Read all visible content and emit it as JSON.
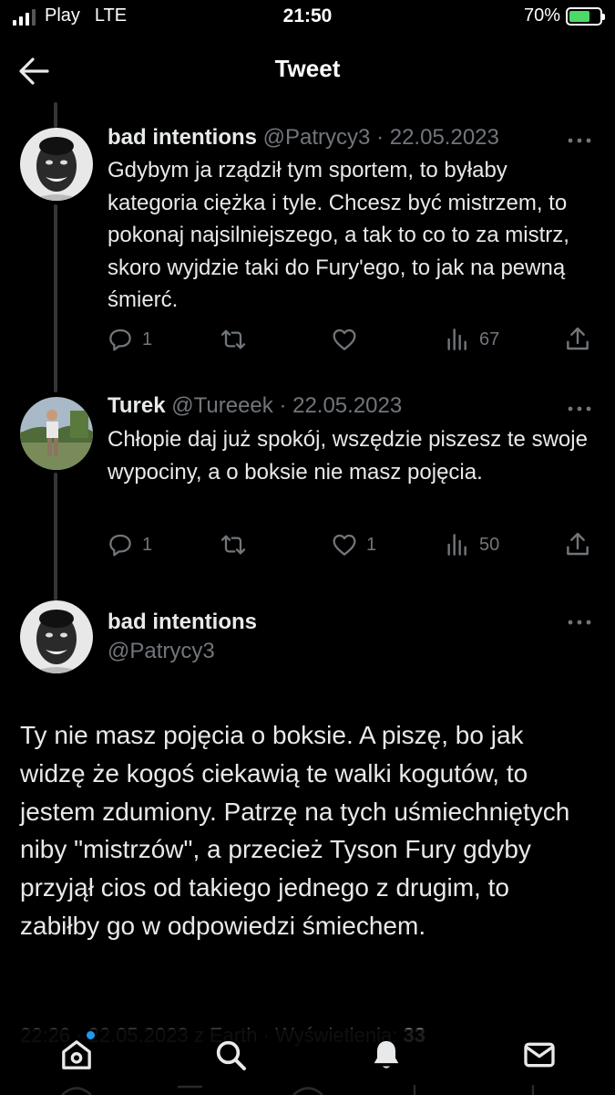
{
  "status_bar": {
    "carrier": "Play",
    "network": "LTE",
    "time": "21:50",
    "battery": "70%",
    "battery_level": 0.7
  },
  "header": {
    "title": "Tweet",
    "back_icon": "arrow-left-icon"
  },
  "replies": [
    {
      "name": "bad intentions",
      "handle": "@Patrycy3",
      "date": "· 22.05.2023",
      "text": "Gdybym ja rządził tym sportem, to byłaby kategoria ciężka i tyle. Chcesz być mistrzem, to pokonaj najsilniejszego, a tak to co to za mistrz, skoro wyjdzie taki do Fury'ego, to jak na pewną śmierć.",
      "replies_count": "1",
      "retweets_count": "",
      "likes_count": "",
      "views_count": "67"
    },
    {
      "name": "Turek",
      "handle": "@Tureeek",
      "date": "· 22.05.2023",
      "text": "Chłopie daj już spokój, wszędzie piszesz te swoje wypociny, a o boksie nie masz pojęcia.",
      "replies_count": "1",
      "retweets_count": "",
      "likes_count": "1",
      "views_count": "50"
    }
  ],
  "main_tweet": {
    "name": "bad intentions",
    "handle": "@Patrycy3",
    "text": "Ty nie masz pojęcia o boksie. A piszę, bo jak widzę że kogoś ciekawią te walki kogutów, to jestem zdumiony. Patrzę na tych uśmiechniętych niby \"mistrzów\", a przecież Tyson Fury gdyby przyjął cios od takiego jednego z drugim, to zabiłby go w odpowiedzi śmiechem.",
    "meta": "22:26 · 22.05.2023 z Earth · Wyświetlenia:",
    "views": "33"
  },
  "tab_bar": {
    "icons": [
      "home-icon",
      "search-icon",
      "notifications-icon",
      "messages-icon"
    ]
  },
  "colors": {
    "background": "#000000",
    "text": "#e7e9ea",
    "secondary": "#71767b",
    "accent": "#1d9bf0",
    "battery": "#4cd964"
  }
}
